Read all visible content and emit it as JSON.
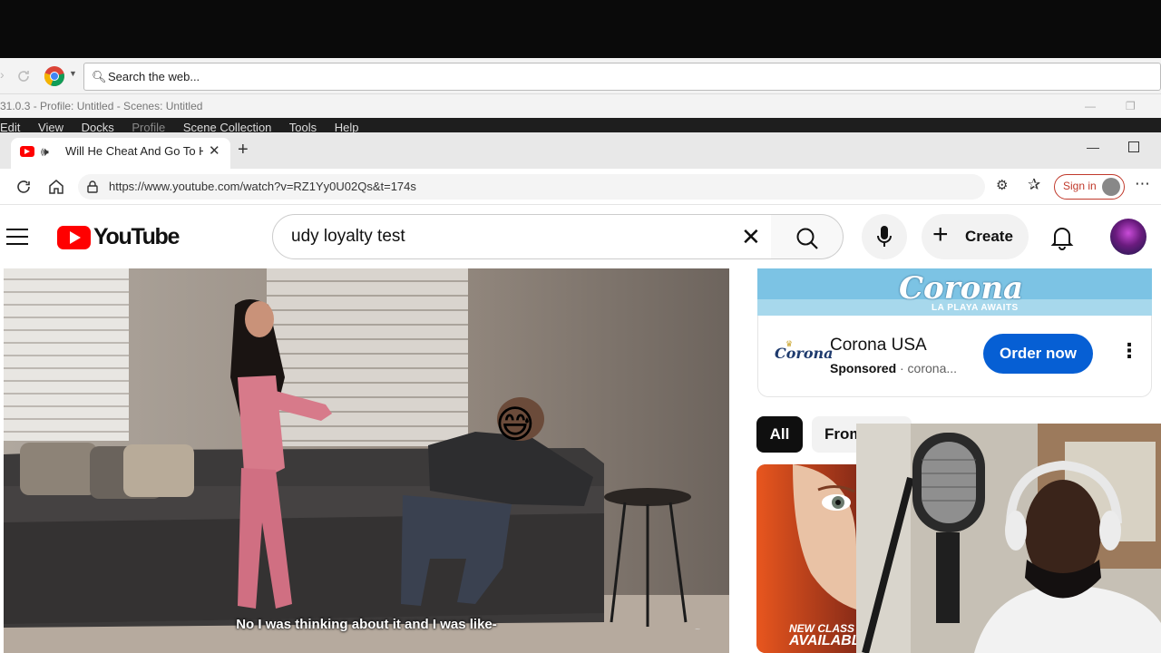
{
  "obs": {
    "search_placeholder": "Search the web...",
    "title": "31.0.3 - Profile: Untitled - Scenes: Untitled",
    "menu": [
      "Edit",
      "View",
      "Docks",
      "Profile",
      "Scene Collection",
      "Tools",
      "Help"
    ]
  },
  "browser": {
    "tab_title": "Will He Cheat And Go To Hell",
    "url": "https://www.youtube.com/watch?v=RZ1Yy0U02Qs&t=174s",
    "sign_in": "Sign in"
  },
  "youtube": {
    "logo_text": "YouTube",
    "search_query": "udy loyalty test",
    "create_label": "Create"
  },
  "video": {
    "caption": "No I was thinking about it and I was like-",
    "emoji": "😅"
  },
  "ad": {
    "banner_brand": "Corona",
    "banner_tagline": "LA PLAYA AWAITS",
    "logo_text": "Corona",
    "advertiser": "Corona USA",
    "sponsored": "Sponsored",
    "domain": "· corona...",
    "cta": "Order now"
  },
  "chips": [
    "All",
    "From"
  ],
  "thumbnail": {
    "line1": "NEW CLASS",
    "line2": "AVAILABL"
  },
  "colors": {
    "yt_red": "#ff0000",
    "order_blue": "#065fd4",
    "corona_sky": "#7cc3e4"
  }
}
